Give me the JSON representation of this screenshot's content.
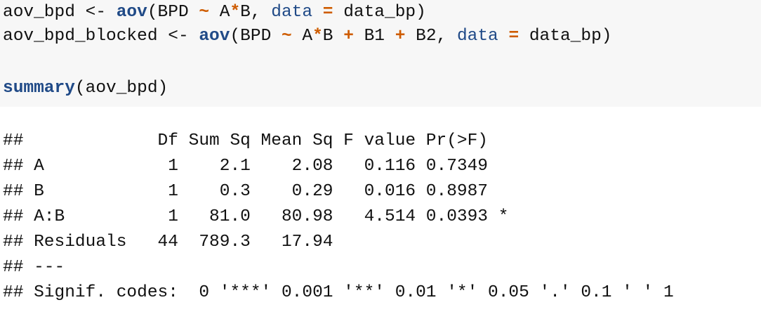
{
  "code": {
    "line1": {
      "lhs": "aov_bpd <- ",
      "fn": "aov",
      "p1": "(BPD ",
      "tilde": "~",
      "p2": " A",
      "star": "*",
      "p3": "B, ",
      "arg": "data",
      "p4": " ",
      "eq": "=",
      "p5": " data_bp)"
    },
    "line2": {
      "lhs": "aov_bpd_blocked <- ",
      "fn": "aov",
      "p1": "(BPD ",
      "tilde": "~",
      "p2": " A",
      "star": "*",
      "p3": "B ",
      "plus1": "+",
      "p4": " B1 ",
      "plus2": "+",
      "p5": " B2, ",
      "arg": "data",
      "p6": " ",
      "eq": "=",
      "p7": " data_bp)"
    },
    "line3": {
      "fn": "summary",
      "rest": "(aov_bpd)"
    }
  },
  "output": {
    "lines": [
      "##             Df Sum Sq Mean Sq F value Pr(>F)  ",
      "## A            1    2.1    2.08   0.116 0.7349  ",
      "## B            1    0.3    0.29   0.016 0.8987  ",
      "## A:B          1   81.0   80.98   4.514 0.0393 *",
      "## Residuals   44  789.3   17.94                 ",
      "## ---",
      "## Signif. codes:  0 '***' 0.001 '**' 0.01 '*' 0.05 '.' 0.1 ' ' 1"
    ]
  }
}
